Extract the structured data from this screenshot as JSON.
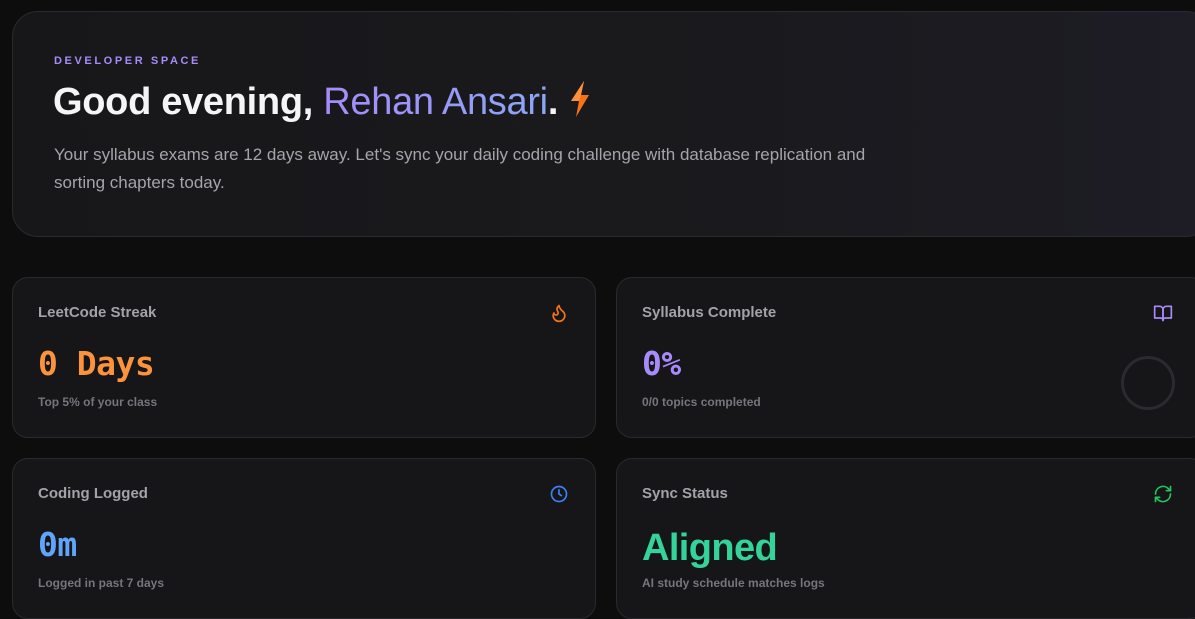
{
  "hero": {
    "eyebrow": "DEVELOPER SPACE",
    "greeting_prefix": "Good evening, ",
    "user_name": "Rehan Ansari",
    "greeting_suffix": ".",
    "subtitle": "Your syllabus exams are 12 days away. Let's sync your daily coding challenge with database replication and sorting chapters today."
  },
  "cards": {
    "leetcode": {
      "title": "LeetCode Streak",
      "value": "0 Days",
      "caption": "Top 5% of your class",
      "icon": "flame-icon",
      "color": "#fb923c"
    },
    "syllabus": {
      "title": "Syllabus Complete",
      "value": "0%",
      "caption": "0/0 topics completed",
      "icon": "book-open-icon",
      "color": "#a78bfa",
      "progress": 0
    },
    "coding": {
      "title": "Coding Logged",
      "value": "0m",
      "caption": "Logged in past 7 days",
      "icon": "clock-icon",
      "color": "#60a5fa"
    },
    "sync": {
      "title": "Sync Status",
      "value": "Aligned",
      "caption": "AI study schedule matches logs",
      "icon": "refresh-icon",
      "color": "#34d399"
    }
  },
  "colors": {
    "accent_purple": "#a78bfa",
    "accent_blue": "#8aa7f7",
    "bolt_orange": "#f97316"
  }
}
